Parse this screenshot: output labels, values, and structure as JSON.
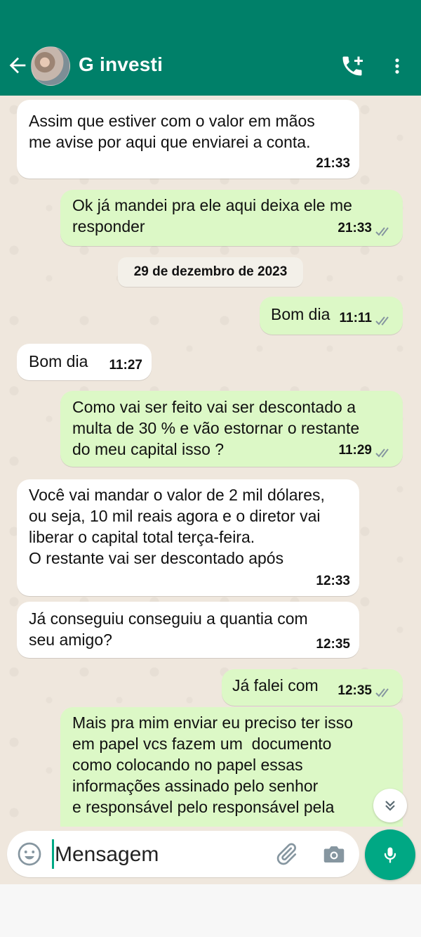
{
  "header": {
    "title": "G investi",
    "colors": {
      "bar": "#008069"
    },
    "icons": [
      "arrow-left-icon",
      "avatar",
      "add-call-icon",
      "more-vert-icon"
    ]
  },
  "date_separator": "29 de dezembro de 2023",
  "messages": [
    {
      "direction": "in",
      "text": "Assim que estiver com o valor em mãos\nme avise por aqui que enviarei a conta.",
      "time": "21:33"
    },
    {
      "direction": "out",
      "text": "Ok já mandei pra ele aqui deixa ele me\nresponder",
      "time": "21:33",
      "status": "read"
    },
    {
      "direction": "out",
      "text": "Bom dia",
      "time": "11:11",
      "status": "read"
    },
    {
      "direction": "in",
      "text": "Bom dia",
      "time": "11:27"
    },
    {
      "direction": "out",
      "text": "Como vai ser feito vai ser descontado a\nmulta de 30 % e vão estornar o restante\ndo meu capital isso ?",
      "time": "11:29",
      "status": "read"
    },
    {
      "direction": "in",
      "text": "Você vai mandar o valor de 2 mil dólares,\nou seja, 10 mil reais agora e o diretor vai\nliberar o capital total terça-feira.\nO restante vai ser descontado após",
      "time": "12:33"
    },
    {
      "direction": "in",
      "text": "Já conseguiu conseguiu a quantia com\nseu amigo?",
      "time": "12:35"
    },
    {
      "direction": "out",
      "text": "Já falei com",
      "time": "12:35",
      "status": "read"
    },
    {
      "direction": "out",
      "text": "Mais pra mim enviar eu preciso ter isso\nem papel vcs fazem um  documento\ncomo colocando no papel essas\ninformações assinado pelo senhor\ne responsável pelo responsável pela",
      "time": "",
      "status": ""
    }
  ],
  "composer": {
    "placeholder": "Mensagem",
    "icons": [
      "emoji-icon",
      "attach-icon",
      "camera-icon",
      "mic-icon"
    ]
  },
  "colors": {
    "incoming": "#ffffff",
    "outgoing": "#dcf8c6",
    "wallpaper": "#efe7dd",
    "accent": "#00a884",
    "read_ticks": "#8696a0"
  }
}
